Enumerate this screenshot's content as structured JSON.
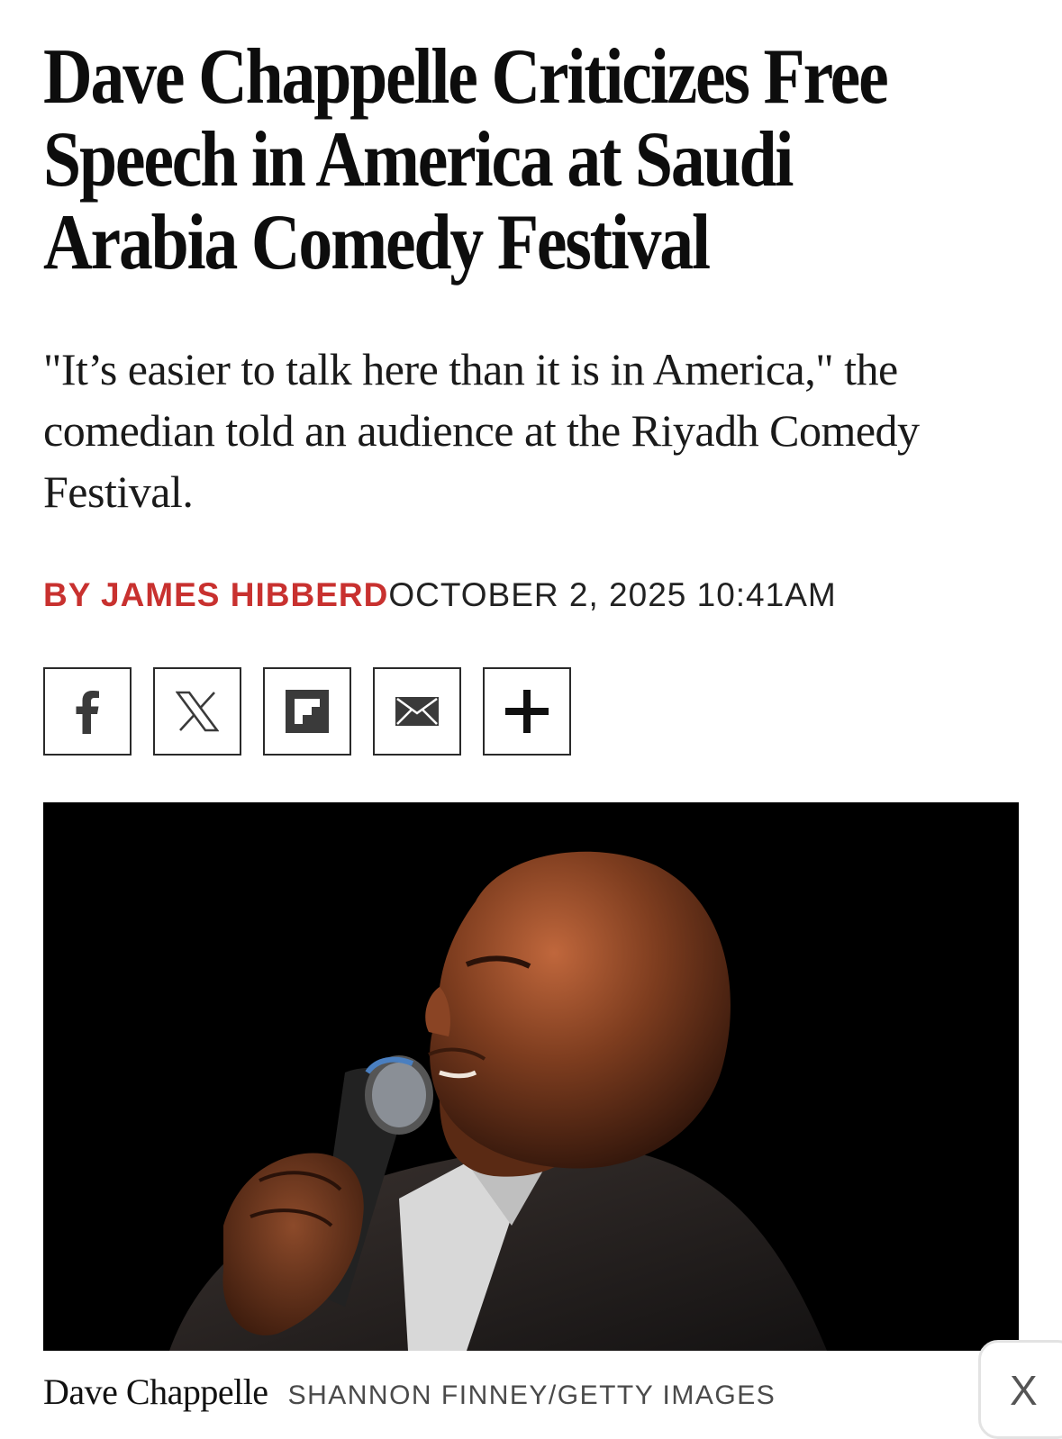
{
  "article": {
    "headline": "Dave Chappelle Criticizes Free Speech in America at Saudi Arabia Comedy Festival",
    "dek": "\"It’s easier to talk here than it is in America,\" the comedian told an audience at the Riyadh Comedy Festival.",
    "byline": "BY JAMES HIBBERD",
    "date": "OCTOBER 2, 2025 10:41AM"
  },
  "share": {
    "buttons": [
      {
        "icon": "facebook-icon"
      },
      {
        "icon": "x-icon"
      },
      {
        "icon": "flipboard-icon"
      },
      {
        "icon": "email-icon"
      },
      {
        "icon": "plus-icon"
      }
    ]
  },
  "photo": {
    "caption": "Dave Chappelle",
    "credit": "SHANNON FINNEY/GETTY IMAGES"
  },
  "overlay": {
    "close_label": "X"
  },
  "colors": {
    "byline_accent": "#c8312f",
    "text": "#111111",
    "photo_background": "#000000"
  }
}
